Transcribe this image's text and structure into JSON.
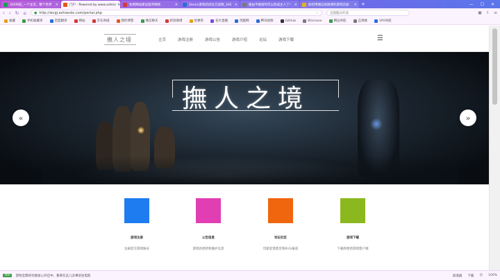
{
  "browser": {
    "tabs": [
      {
        "label": "360导航_一个主页，整个世界",
        "color": "#1aa14a",
        "active": false
      },
      {
        "label": "门户 - Powered by www.admin",
        "color": "#e05a1a",
        "active": true
      },
      {
        "label": "免费网站建设程序网络",
        "color": "#d23a3a",
        "active": false
      },
      {
        "label": "Steam游戏的优化方案啊_360",
        "color": "#2a6ed6",
        "active": false
      },
      {
        "label": "路由不联接时可以改成主人了!",
        "color": "#7a7a7a",
        "active": false
      },
      {
        "label": "如何用微信给微博的游戏页加",
        "color": "#e3b21a",
        "active": false
      }
    ],
    "new_tab": "+",
    "window_controls": [
      "—",
      "☐",
      "✕"
    ],
    "back": "‹",
    "forward": "›",
    "refresh": "↻",
    "home": "⌂",
    "url": "http://wcgj.eshiandx.com/portal.php",
    "search_placeholder": "石圆脑分的波",
    "bookmarks": [
      {
        "label": "收藏",
        "color": "#e3a21a"
      },
      {
        "label": "手机收藏夹",
        "color": "#3a9d48"
      },
      {
        "label": "百度翻译",
        "color": "#2a6ed6"
      },
      {
        "label": "网站",
        "color": "#d23a3a"
      },
      {
        "label": "京东商城",
        "color": "#d23a3a"
      },
      {
        "label": "我的博客",
        "color": "#e05a1a"
      },
      {
        "label": "微信聊天",
        "color": "#3a9d48"
      },
      {
        "label": "新浪微博",
        "color": "#d23a3a"
      },
      {
        "label": "优惠卷",
        "color": "#e3a21a"
      },
      {
        "label": "名片直播",
        "color": "#7a4ad6"
      },
      {
        "label": "优酷网",
        "color": "#2a6ed6"
      },
      {
        "label": "腾讯视频",
        "color": "#2a6ed6"
      },
      {
        "label": "GitHub",
        "color": "#333333"
      },
      {
        "label": "Wicresoo",
        "color": "#7a7a7a"
      },
      {
        "label": "网址导航",
        "color": "#3a9d48"
      },
      {
        "label": "正清联",
        "color": "#7a7a7a"
      },
      {
        "label": "VAS导航",
        "color": "#2a6ed6"
      }
    ]
  },
  "site": {
    "logo": "撫人之境",
    "nav": [
      "主页",
      "游戏注册",
      "游戏公告",
      "游戏介绍",
      "论坛",
      "游戏下载"
    ],
    "menu_icon": "☰",
    "banner_title": "撫人之境",
    "arrow_left": "«",
    "arrow_right": "»",
    "features": [
      {
        "title": "游戏注册",
        "desc": "注册官方游戏账号",
        "color": "#1e7bf0"
      },
      {
        "title": "公告信息",
        "desc": "游戏的更新和维护信息",
        "color": "#e23eb4"
      },
      {
        "title": "论坛社区",
        "desc": "玩家反馈意见和BUG报道",
        "color": "#f0660e"
      },
      {
        "title": "游戏下载",
        "desc": "下载和更新游戏客户端",
        "color": "#8bb81e"
      }
    ]
  },
  "status": {
    "badge": "360",
    "left_text": "游戏宝典将功能核心开启中，看来在这儿没事前往电影",
    "right_items": [
      "加速器",
      "下载",
      "☺",
      "100%"
    ]
  }
}
